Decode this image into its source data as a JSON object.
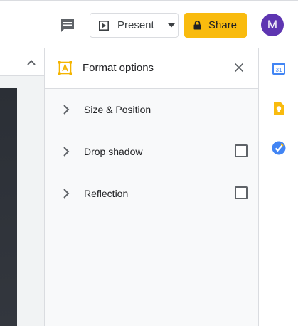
{
  "topbar": {
    "comment_icon": "comment-icon",
    "present": {
      "label": "Present",
      "icon": "present-icon",
      "dropdown_icon": "caret-down-icon"
    },
    "share": {
      "label": "Share",
      "icon": "lock-icon",
      "color": "#f9bb0e"
    },
    "avatar": {
      "initial": "M",
      "color": "#5e35b1"
    }
  },
  "slide_area": {
    "collapse_icon": "chevron-up-icon"
  },
  "panel": {
    "title": "Format options",
    "title_icon": "format-options-icon",
    "close_icon": "close-icon",
    "sections": [
      {
        "label": "Size & Position",
        "has_checkbox": false,
        "checked": false
      },
      {
        "label": "Drop shadow",
        "has_checkbox": true,
        "checked": false
      },
      {
        "label": "Reflection",
        "has_checkbox": true,
        "checked": false
      }
    ]
  },
  "siderail": {
    "items": [
      {
        "name": "calendar-icon",
        "text": "31",
        "color": "#4285f4"
      },
      {
        "name": "keep-icon",
        "color": "#f9bb0e"
      },
      {
        "name": "tasks-icon",
        "color": "#4285f4"
      }
    ]
  }
}
